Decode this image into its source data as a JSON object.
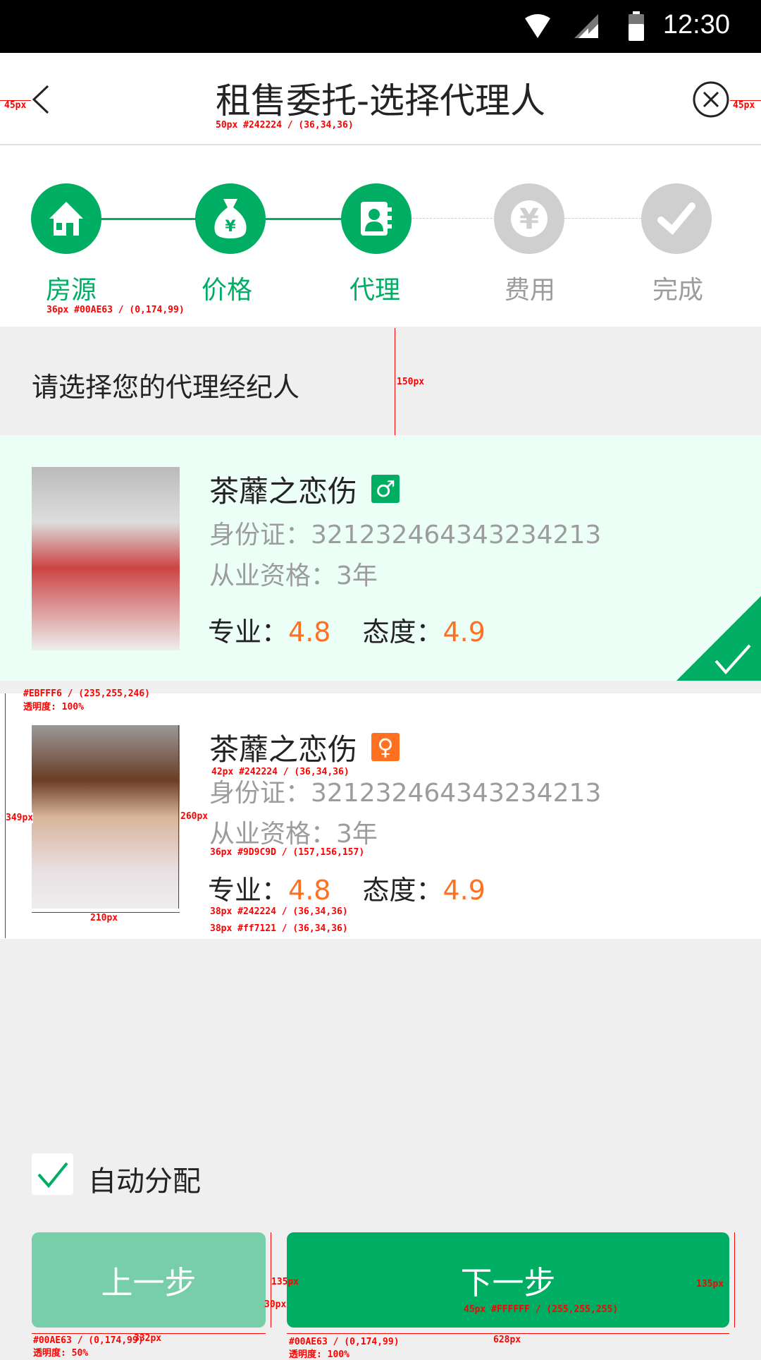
{
  "status_bar": {
    "time": "12:30",
    "icons": [
      "wifi-icon",
      "signal-icon",
      "battery-icon"
    ]
  },
  "header": {
    "title": "租售委托-选择代理人",
    "back_icon": "chevron-left-icon",
    "close_icon": "close-circle-icon"
  },
  "steps": [
    {
      "label": "房源",
      "icon": "house-icon",
      "state": "done"
    },
    {
      "label": "价格",
      "icon": "money-bag-icon",
      "state": "done"
    },
    {
      "label": "代理",
      "icon": "contact-book-icon",
      "state": "current"
    },
    {
      "label": "费用",
      "icon": "yen-icon",
      "state": "pending"
    },
    {
      "label": "完成",
      "icon": "check-icon",
      "state": "pending"
    }
  ],
  "section_title": "请选择您的代理经纪人",
  "agents": [
    {
      "name": "茶蘼之恋伤",
      "gender": "male",
      "gender_symbol": "♂",
      "id_label": "身份证：",
      "id": "321232464343234213",
      "exp_label": "从业资格：",
      "exp": "3年",
      "pro_label": "专业：",
      "pro": "4.8",
      "att_label": "态度：",
      "att": "4.9",
      "selected": true
    },
    {
      "name": "茶蘼之恋伤",
      "gender": "female",
      "gender_symbol": "♀",
      "id_label": "身份证：",
      "id": "321232464343234213",
      "exp_label": "从业资格：",
      "exp": "3年",
      "pro_label": "专业：",
      "pro": "4.8",
      "att_label": "态度：",
      "att": "4.9",
      "selected": false
    }
  ],
  "auto_assign": {
    "label": "自动分配",
    "checked": true
  },
  "buttons": {
    "prev": "上一步",
    "next": "下一步"
  },
  "colors": {
    "accent": "#00AE63",
    "selected_bg": "#EBFFF6",
    "text": "#242224",
    "muted": "#9D9C9D",
    "rating": "#ff7121",
    "male": "#00AE63",
    "female": "#ff7121"
  },
  "annotations": {
    "a1": "45px",
    "a2": "45px",
    "a3": "50px #242224 / (36,34,36)",
    "a4": "36px #00AE63 / (0,174,99)",
    "a5": "150px",
    "a6": "#EBFFF6 / (235,255,246)",
    "a7": "透明度: 100%",
    "a8": "349px",
    "a9": "260px",
    "a10": "210px",
    "a11": "42px #242224 / (36,34,36)",
    "a12": "36px #9D9C9D / (157,156,157)",
    "a13": "38px #242224 / (36,34,36)",
    "a14": "38px #ff7121 / (36,34,36)",
    "a15": "135px",
    "a16": "30px",
    "a17": "135px",
    "a18": "45px #FFFFFF / (255,255,255)",
    "a19": "#00AE63 / (0,174,99)",
    "a20": "透明度: 50%",
    "a21": "332px",
    "a22": "#00AE63 / (0,174,99)",
    "a23": "透明度: 100%",
    "a24": "628px"
  }
}
